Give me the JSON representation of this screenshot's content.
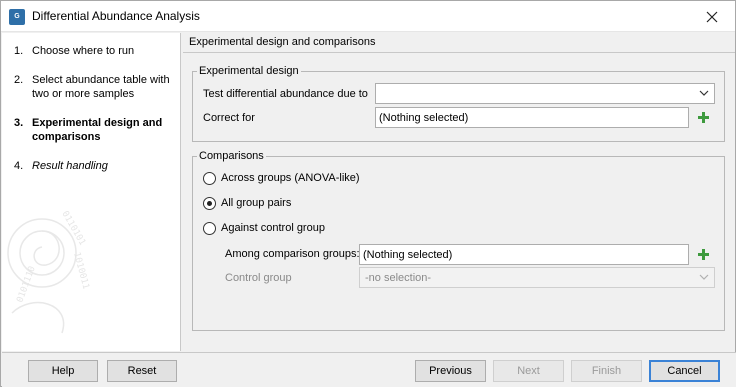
{
  "window": {
    "title": "Differential Abundance Analysis",
    "app_icon": "G",
    "close_icon": "close-icon"
  },
  "steps": [
    {
      "num": "1.",
      "label": "Choose where to run"
    },
    {
      "num": "2.",
      "label": "Select abundance table with two or more samples"
    },
    {
      "num": "3.",
      "label": "Experimental design and comparisons"
    },
    {
      "num": "4.",
      "label": "Result handling"
    }
  ],
  "content": {
    "title": "Experimental design and comparisons",
    "experimental_design": {
      "legend": "Experimental design",
      "test_label": "Test differential abundance due to",
      "test_value": "",
      "correct_for_label": "Correct for",
      "correct_for_value": "(Nothing selected)"
    },
    "comparisons": {
      "legend": "Comparisons",
      "options": [
        {
          "label": "Across groups (ANOVA-like)",
          "selected": false
        },
        {
          "label": "All group pairs",
          "selected": true
        },
        {
          "label": "Against control group",
          "selected": false
        }
      ],
      "among_label": "Among comparison groups:",
      "among_value": "(Nothing selected)",
      "control_label": "Control group",
      "control_value": "-no selection-"
    }
  },
  "buttons": {
    "help": "Help",
    "reset": "Reset",
    "previous": "Previous",
    "next": "Next",
    "finish": "Finish",
    "cancel": "Cancel"
  },
  "colors": {
    "add_icon": "#3e9a3e",
    "default_button_border": "#3a82d6"
  }
}
